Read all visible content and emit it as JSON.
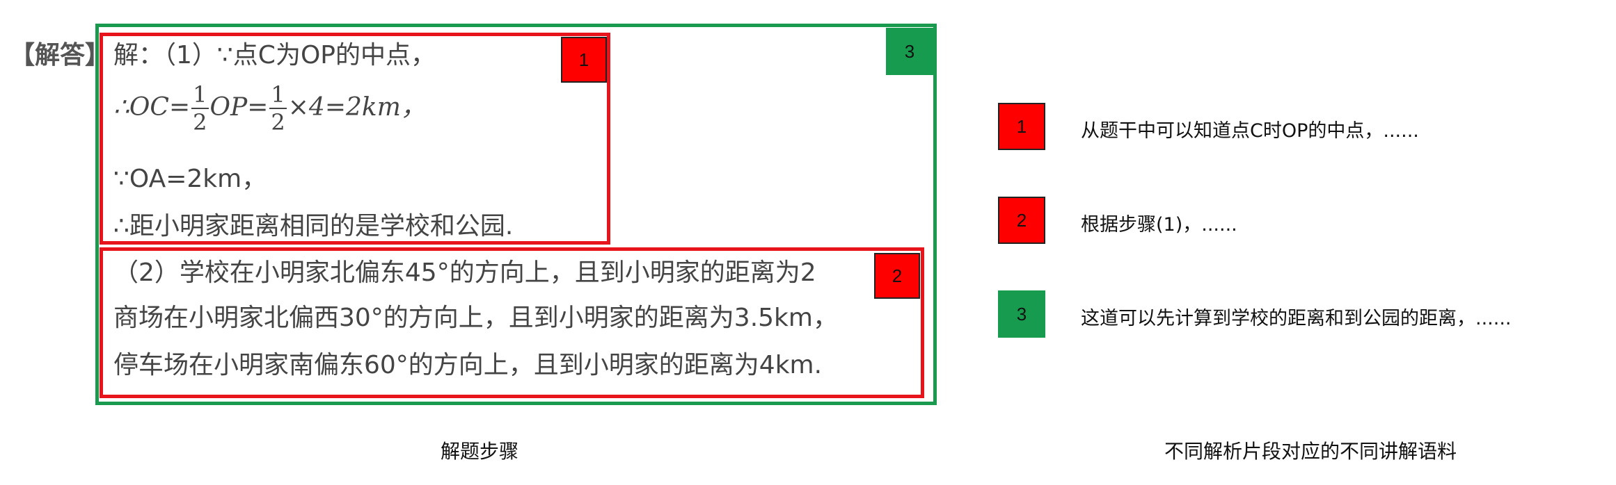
{
  "answer_label": "【解答】",
  "solution": {
    "line1": "解：（1）∵点C为OP的中点，",
    "line2": {
      "prefix": "∴OC=",
      "frac1_num": "1",
      "frac1_den": "2",
      "middle": "OP=",
      "frac2_num": "1",
      "frac2_den": "2",
      "suffix": "×4=2km，"
    },
    "line3": "∵OA=2km，",
    "line4": "∴距小明家距离相同的是学校和公园.",
    "line5": "（2）学校在小明家北偏东45°的方向上，且到小明家的距离为2",
    "line6": "商场在小明家北偏西30°的方向上，且到小明家的距离为3.5km，",
    "line7": "停车场在小明家南偏东60°的方向上，且到小明家的距离为4km."
  },
  "badges": {
    "b1": "1",
    "b2": "2",
    "b3": "3"
  },
  "legend": [
    {
      "number": "1",
      "color": "#ff0000",
      "text": "从题干中可以知道点C时OP的中点，......"
    },
    {
      "number": "2",
      "color": "#ff0000",
      "text": "根据步骤(1)，......"
    },
    {
      "number": "3",
      "color": "#179c4f",
      "text": "这道可以先计算到学校的距离和到公园的距离，......"
    }
  ],
  "captions": {
    "left": "解题步骤",
    "right": "不同解析片段对应的不同讲解语料"
  }
}
